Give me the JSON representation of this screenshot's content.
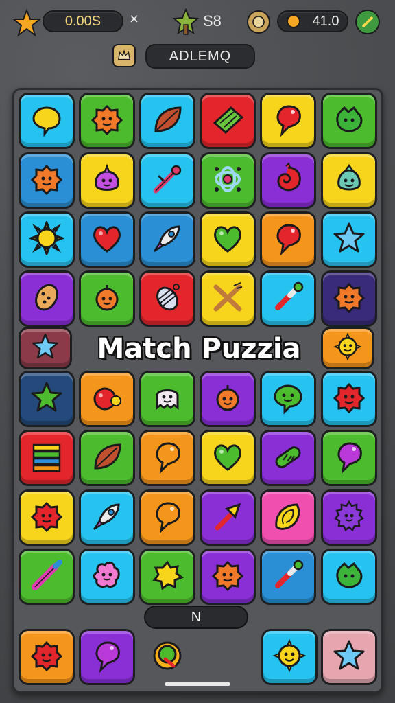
{
  "hud": {
    "score_value": "0.00S",
    "close_symbol": "×",
    "stars_value": "S8",
    "coins_value": "41.0",
    "title_bar_text": "ADLEMQ"
  },
  "banner": {
    "title": "Match Puzzia"
  },
  "bottom": {
    "pill_label": "N"
  },
  "colors": {
    "yellow": "#f7d51c",
    "green": "#4cbb2e",
    "cyan": "#27c3f0",
    "red": "#e2262b",
    "orange": "#f5961c",
    "purple": "#8a2fd6",
    "blue": "#2a8fd4",
    "navy": "#234a7a",
    "indigo": "#3a2a7a",
    "maroon": "#8a3a48",
    "pink": "#f14fb0",
    "rose": "#e6a6b0",
    "lime": "#5ac23a"
  },
  "tiles": [
    {
      "row": 0,
      "col": 0,
      "color": "cyan",
      "icon": "speech-bubble-icon"
    },
    {
      "row": 0,
      "col": 1,
      "color": "green",
      "icon": "orange-blob-icon"
    },
    {
      "row": 0,
      "col": 2,
      "color": "cyan",
      "icon": "leaf-icon"
    },
    {
      "row": 0,
      "col": 3,
      "color": "red",
      "icon": "green-leaf-icon"
    },
    {
      "row": 0,
      "col": 4,
      "color": "yellow",
      "icon": "red-bubble-icon"
    },
    {
      "row": 0,
      "col": 5,
      "color": "green",
      "icon": "green-blob-icon"
    },
    {
      "row": 1,
      "col": 0,
      "color": "blue",
      "icon": "orange-blob-icon"
    },
    {
      "row": 1,
      "col": 1,
      "color": "yellow",
      "icon": "purple-blob-icon"
    },
    {
      "row": 1,
      "col": 2,
      "color": "cyan",
      "icon": "wand-icon"
    },
    {
      "row": 1,
      "col": 3,
      "color": "green",
      "icon": "atom-icon"
    },
    {
      "row": 1,
      "col": 4,
      "color": "purple",
      "icon": "red-swirl-icon"
    },
    {
      "row": 1,
      "col": 5,
      "color": "yellow",
      "icon": "teal-blob-icon"
    },
    {
      "row": 2,
      "col": 0,
      "color": "cyan",
      "icon": "sun-icon"
    },
    {
      "row": 2,
      "col": 1,
      "color": "blue",
      "icon": "heart-icon"
    },
    {
      "row": 2,
      "col": 2,
      "color": "blue",
      "icon": "rocket-icon"
    },
    {
      "row": 2,
      "col": 3,
      "color": "yellow",
      "icon": "green-heart-icon"
    },
    {
      "row": 2,
      "col": 4,
      "color": "orange",
      "icon": "red-bubble-icon"
    },
    {
      "row": 2,
      "col": 5,
      "color": "cyan",
      "icon": "star-icon"
    },
    {
      "row": 3,
      "col": 0,
      "color": "purple",
      "icon": "cookie-icon"
    },
    {
      "row": 3,
      "col": 1,
      "color": "green",
      "icon": "orange-fruit-icon"
    },
    {
      "row": 3,
      "col": 2,
      "color": "red",
      "icon": "grill-icon"
    },
    {
      "row": 3,
      "col": 3,
      "color": "yellow",
      "icon": "crossed-sticks-icon"
    },
    {
      "row": 3,
      "col": 4,
      "color": "cyan",
      "icon": "paint-brush-icon"
    },
    {
      "row": 3,
      "col": 5,
      "color": "indigo",
      "icon": "orange-blob-icon"
    },
    {
      "row": 4,
      "col": 0,
      "color": "maroon",
      "icon": "star-icon"
    },
    {
      "row": 4,
      "col": 5,
      "color": "orange",
      "icon": "sun-face-icon"
    },
    {
      "row": 5,
      "col": 0,
      "color": "navy",
      "icon": "green-star-icon"
    },
    {
      "row": 5,
      "col": 1,
      "color": "orange",
      "icon": "tomato-icon"
    },
    {
      "row": 5,
      "col": 2,
      "color": "green",
      "icon": "ghost-icon"
    },
    {
      "row": 5,
      "col": 3,
      "color": "purple",
      "icon": "orange-fruit-icon"
    },
    {
      "row": 5,
      "col": 4,
      "color": "cyan",
      "icon": "green-bubble-icon"
    },
    {
      "row": 5,
      "col": 5,
      "color": "cyan",
      "icon": "red-blob-icon"
    },
    {
      "row": 6,
      "col": 0,
      "color": "red",
      "icon": "stack-icon"
    },
    {
      "row": 6,
      "col": 1,
      "color": "green",
      "icon": "leaf-icon"
    },
    {
      "row": 6,
      "col": 2,
      "color": "orange",
      "icon": "orange-bubble-icon"
    },
    {
      "row": 6,
      "col": 3,
      "color": "yellow",
      "icon": "green-heart-icon"
    },
    {
      "row": 6,
      "col": 4,
      "color": "purple",
      "icon": "candy-icon"
    },
    {
      "row": 6,
      "col": 5,
      "color": "green",
      "icon": "purple-bubble-icon"
    },
    {
      "row": 7,
      "col": 0,
      "color": "yellow",
      "icon": "red-blob-icon"
    },
    {
      "row": 7,
      "col": 1,
      "color": "cyan",
      "icon": "rocket-icon"
    },
    {
      "row": 7,
      "col": 2,
      "color": "orange",
      "icon": "orange-bubble-icon"
    },
    {
      "row": 7,
      "col": 3,
      "color": "purple",
      "icon": "arrow-icon"
    },
    {
      "row": 7,
      "col": 4,
      "color": "pink",
      "icon": "shell-icon"
    },
    {
      "row": 7,
      "col": 5,
      "color": "purple",
      "icon": "purple-gear-icon"
    },
    {
      "row": 8,
      "col": 0,
      "color": "green",
      "icon": "pencil-icon"
    },
    {
      "row": 8,
      "col": 1,
      "color": "cyan",
      "icon": "pink-blob-icon"
    },
    {
      "row": 8,
      "col": 2,
      "color": "green",
      "icon": "yellow-star-icon"
    },
    {
      "row": 8,
      "col": 3,
      "color": "purple",
      "icon": "orange-blob-icon"
    },
    {
      "row": 8,
      "col": 4,
      "color": "blue",
      "icon": "paint-brush-icon"
    },
    {
      "row": 8,
      "col": 5,
      "color": "cyan",
      "icon": "green-blob-icon"
    },
    {
      "row": 9,
      "col": 0,
      "color": "orange",
      "icon": "red-blob-icon"
    },
    {
      "row": 9,
      "col": 1,
      "color": "purple",
      "icon": "purple-bubble-icon"
    },
    {
      "row": 9,
      "col": 2,
      "color": "none",
      "icon": "green-pin-icon"
    },
    {
      "row": 9,
      "col": 4,
      "color": "cyan",
      "icon": "sun-face-icon"
    },
    {
      "row": 9,
      "col": 5,
      "color": "rose",
      "icon": "star-icon"
    }
  ]
}
